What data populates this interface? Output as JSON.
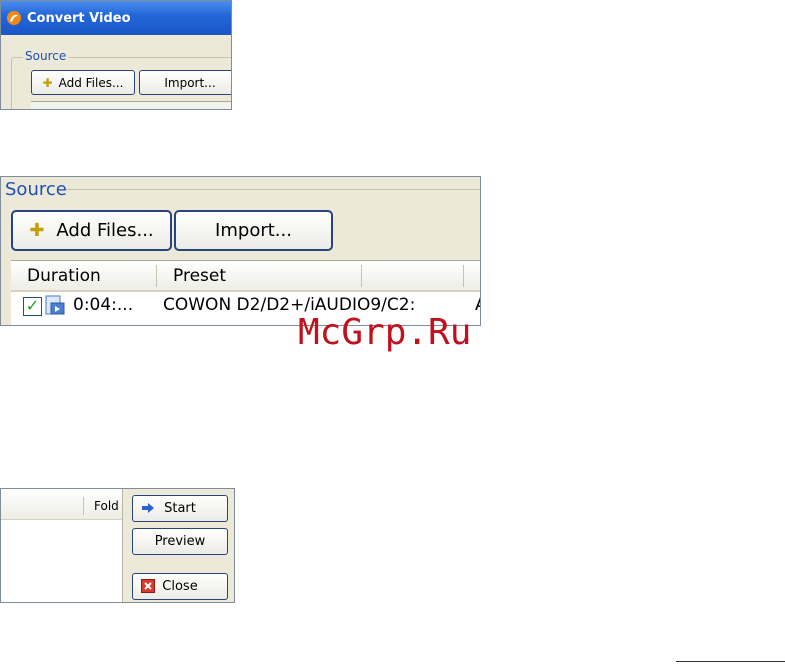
{
  "window": {
    "title": "Convert Video",
    "icon": "app-icon"
  },
  "source_small": {
    "group_label": "Source",
    "add_files_label": "Add Files...",
    "import_label": "Import..."
  },
  "source_zoomed": {
    "group_label": "Source",
    "add_files_label": "Add Files...",
    "import_label": "Import...",
    "columns": [
      "Duration",
      "Preset"
    ],
    "rows": [
      {
        "checked": true,
        "duration": "0:04:...",
        "preset": "COWON D2/D2+/iAUDIO9/C2:",
        "extra": "A"
      }
    ]
  },
  "actions": {
    "column_header": "Fold",
    "start_label": "Start",
    "preview_label": "Preview",
    "close_label": "Close"
  },
  "watermark": "McGrp.Ru",
  "colors": {
    "titlebar_blue": "#2468d8",
    "group_label_blue": "#1f4fb5",
    "dialog_bg": "#ece9d8",
    "watermark_red": "#c0111d"
  }
}
